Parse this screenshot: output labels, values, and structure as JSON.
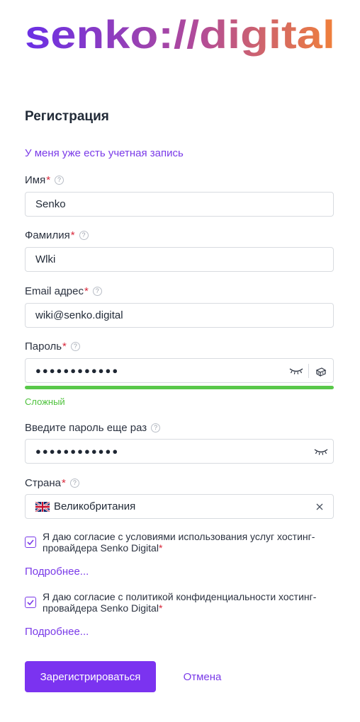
{
  "logo": {
    "text": "senko://digital"
  },
  "form": {
    "title": "Регистрация",
    "login_link": "У меня уже есть учетная запись",
    "required_mark": "*",
    "help_glyph": "?",
    "first_name": {
      "label": "Имя",
      "value": "Senko"
    },
    "last_name": {
      "label": "Фамилия",
      "value": "Wlki"
    },
    "email": {
      "label": "Email адрес",
      "value": "wiki@senko.digital"
    },
    "password": {
      "label": "Пароль",
      "masked_value": "●●●●●●●●●●●●",
      "strength_label": "Сложный",
      "strength_fraction": 1.0
    },
    "password_repeat": {
      "label": "Введите пароль еще раз",
      "masked_value": "●●●●●●●●●●●●"
    },
    "country": {
      "label": "Страна",
      "value": "Великобритания"
    },
    "terms_consent": {
      "checked": true,
      "text": "Я даю согласие с условиями использования услуг хостинг-провайдера Senko Digital",
      "more_link": "Подробнее..."
    },
    "privacy_consent": {
      "checked": true,
      "text": "Я даю согласие с политикой конфиденциальности хостинг-провайдера Senko Digital",
      "more_link": "Подробнее..."
    },
    "submit_label": "Зарегистрироваться",
    "cancel_label": "Отмена"
  },
  "colors": {
    "accent": "#7b33f0",
    "link": "#7a3ae8",
    "required": "#d9283b",
    "strength_good": "#59c84a",
    "logo_gradient": [
      "#6a2fe6",
      "#f0803a"
    ]
  },
  "icons": [
    "eye-closed-icon",
    "password-generator-icon",
    "uk-flag-icon",
    "clear-icon",
    "checkmark-icon",
    "help-icon"
  ]
}
